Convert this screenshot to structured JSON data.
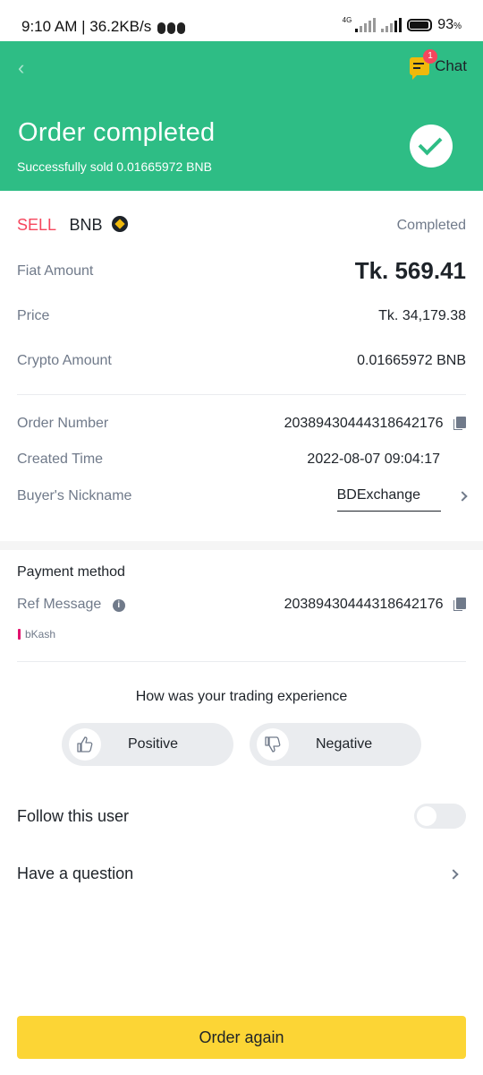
{
  "status_bar": {
    "time_speed": "9:10 AM | 36.2KB/s",
    "network": "4G",
    "battery": "93",
    "battery_unit": "%",
    "battery_level": 0.93
  },
  "header": {
    "back_icon": "back-arrow-icon",
    "chat_label": "Chat",
    "chat_badge": "1",
    "title": "Order completed",
    "subtitle": "Successfully sold  0.01665972 BNB",
    "status_icon": "check-circle-icon",
    "bg_color": "#2ebd85"
  },
  "order": {
    "side": "SELL",
    "coin": "BNB",
    "status": "Completed",
    "fiat_amount_label": "Fiat Amount",
    "fiat_amount": "Tk. 569.41",
    "price_label": "Price",
    "price": "Tk. 34,179.38",
    "crypto_amount_label": "Crypto Amount",
    "crypto_amount": "0.01665972 BNB",
    "order_number_label": "Order Number",
    "order_number": "20389430444318642176",
    "created_time_label": "Created Time",
    "created_time": "2022-08-07 09:04:17",
    "buyer_nickname_label": "Buyer's Nickname",
    "buyer_nickname": "BDExchange"
  },
  "payment": {
    "title": "Payment method",
    "ref_message_label": "Ref Message",
    "ref_message": "20389430444318642176",
    "method": "bKash",
    "method_color": "#e2136e"
  },
  "feedback": {
    "question": "How was your trading experience",
    "positive_label": "Positive",
    "negative_label": "Negative"
  },
  "follow": {
    "label": "Follow this user",
    "enabled": false
  },
  "question": {
    "label": "Have a question"
  },
  "footer": {
    "order_again_label": "Order again",
    "button_color": "#fcd535"
  }
}
